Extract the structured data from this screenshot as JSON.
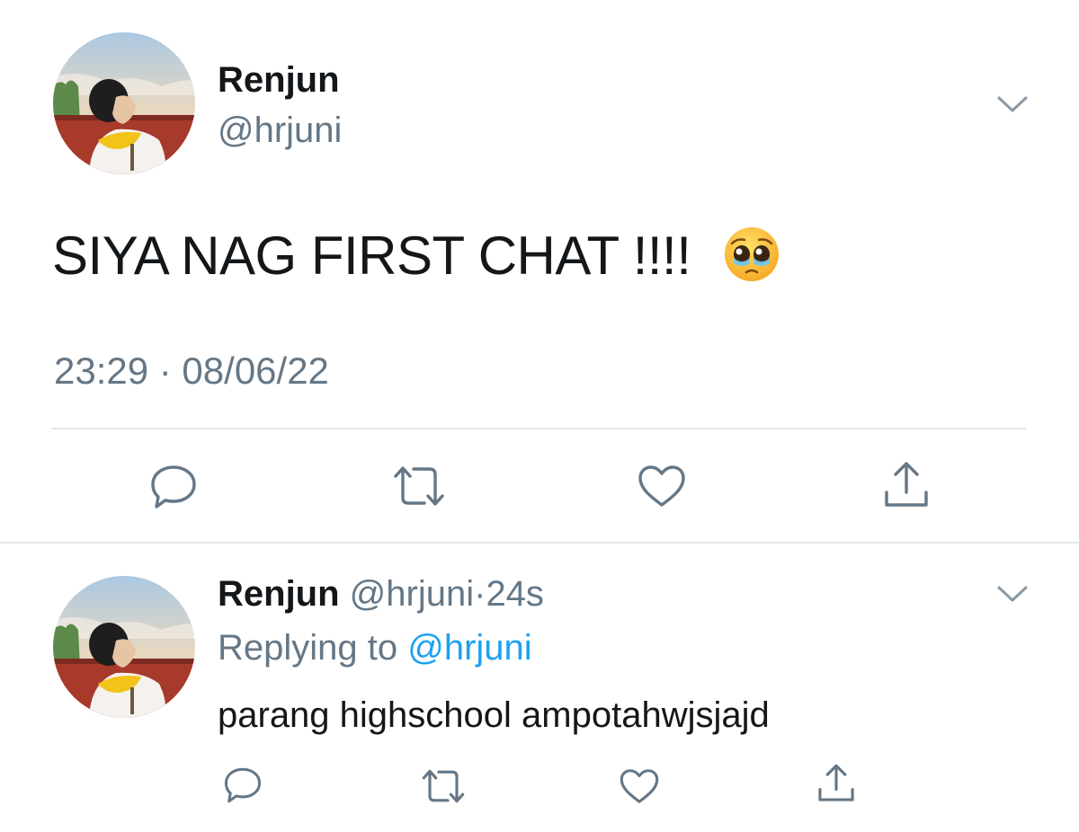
{
  "main_tweet": {
    "display_name": "Renjun",
    "handle": "@hrjuni",
    "text": "SIYA NAG FIRST CHAT !!!!",
    "emoji": "pleading-face",
    "timestamp": "23:29 · 08/06/22",
    "actions": [
      "reply-icon",
      "retweet-icon",
      "like-icon",
      "share-icon"
    ]
  },
  "reply_tweet": {
    "display_name": "Renjun",
    "handle": "@hrjuni",
    "separator": "·",
    "time_ago": "24s",
    "replying_prefix": "Replying to",
    "replying_to": "@hrjuni",
    "text": "parang highschool ampotahwjsjajd",
    "actions": [
      "reply-icon",
      "retweet-icon",
      "like-icon",
      "share-icon"
    ]
  },
  "colors": {
    "text": "#14171a",
    "secondary": "#657786",
    "link": "#1da1f2",
    "divider": "#e1e8ed"
  }
}
